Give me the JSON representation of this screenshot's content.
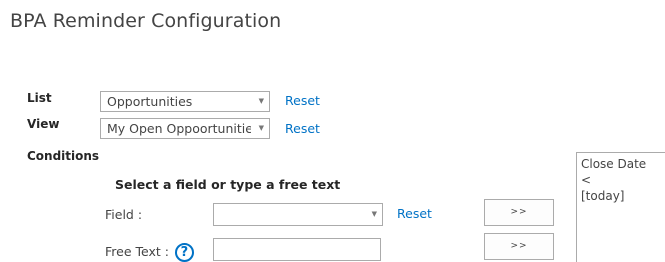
{
  "page": {
    "title": "BPA Reminder Configuration"
  },
  "list": {
    "label": "List",
    "selected": "Opportunities",
    "reset_label": "Reset"
  },
  "view": {
    "label": "View",
    "selected": "My Open Oppoortunities",
    "reset_label": "Reset"
  },
  "conditions": {
    "label": "Conditions",
    "sub_header": "Select a field or type a free text",
    "field": {
      "label": "Field :",
      "selected": "",
      "reset_label": "Reset",
      "add_button_label": ">>"
    },
    "free_text": {
      "label": "Free Text :",
      "help_icon": "?",
      "value": "",
      "add_button_label": ">>"
    },
    "expression_lines": [
      "Close Date",
      "<",
      "[today]"
    ]
  },
  "icons": {
    "dropdown_arrow": "▼",
    "help": "question-circle-icon"
  },
  "colors": {
    "link": "#0072c6",
    "border": "#ababab"
  }
}
